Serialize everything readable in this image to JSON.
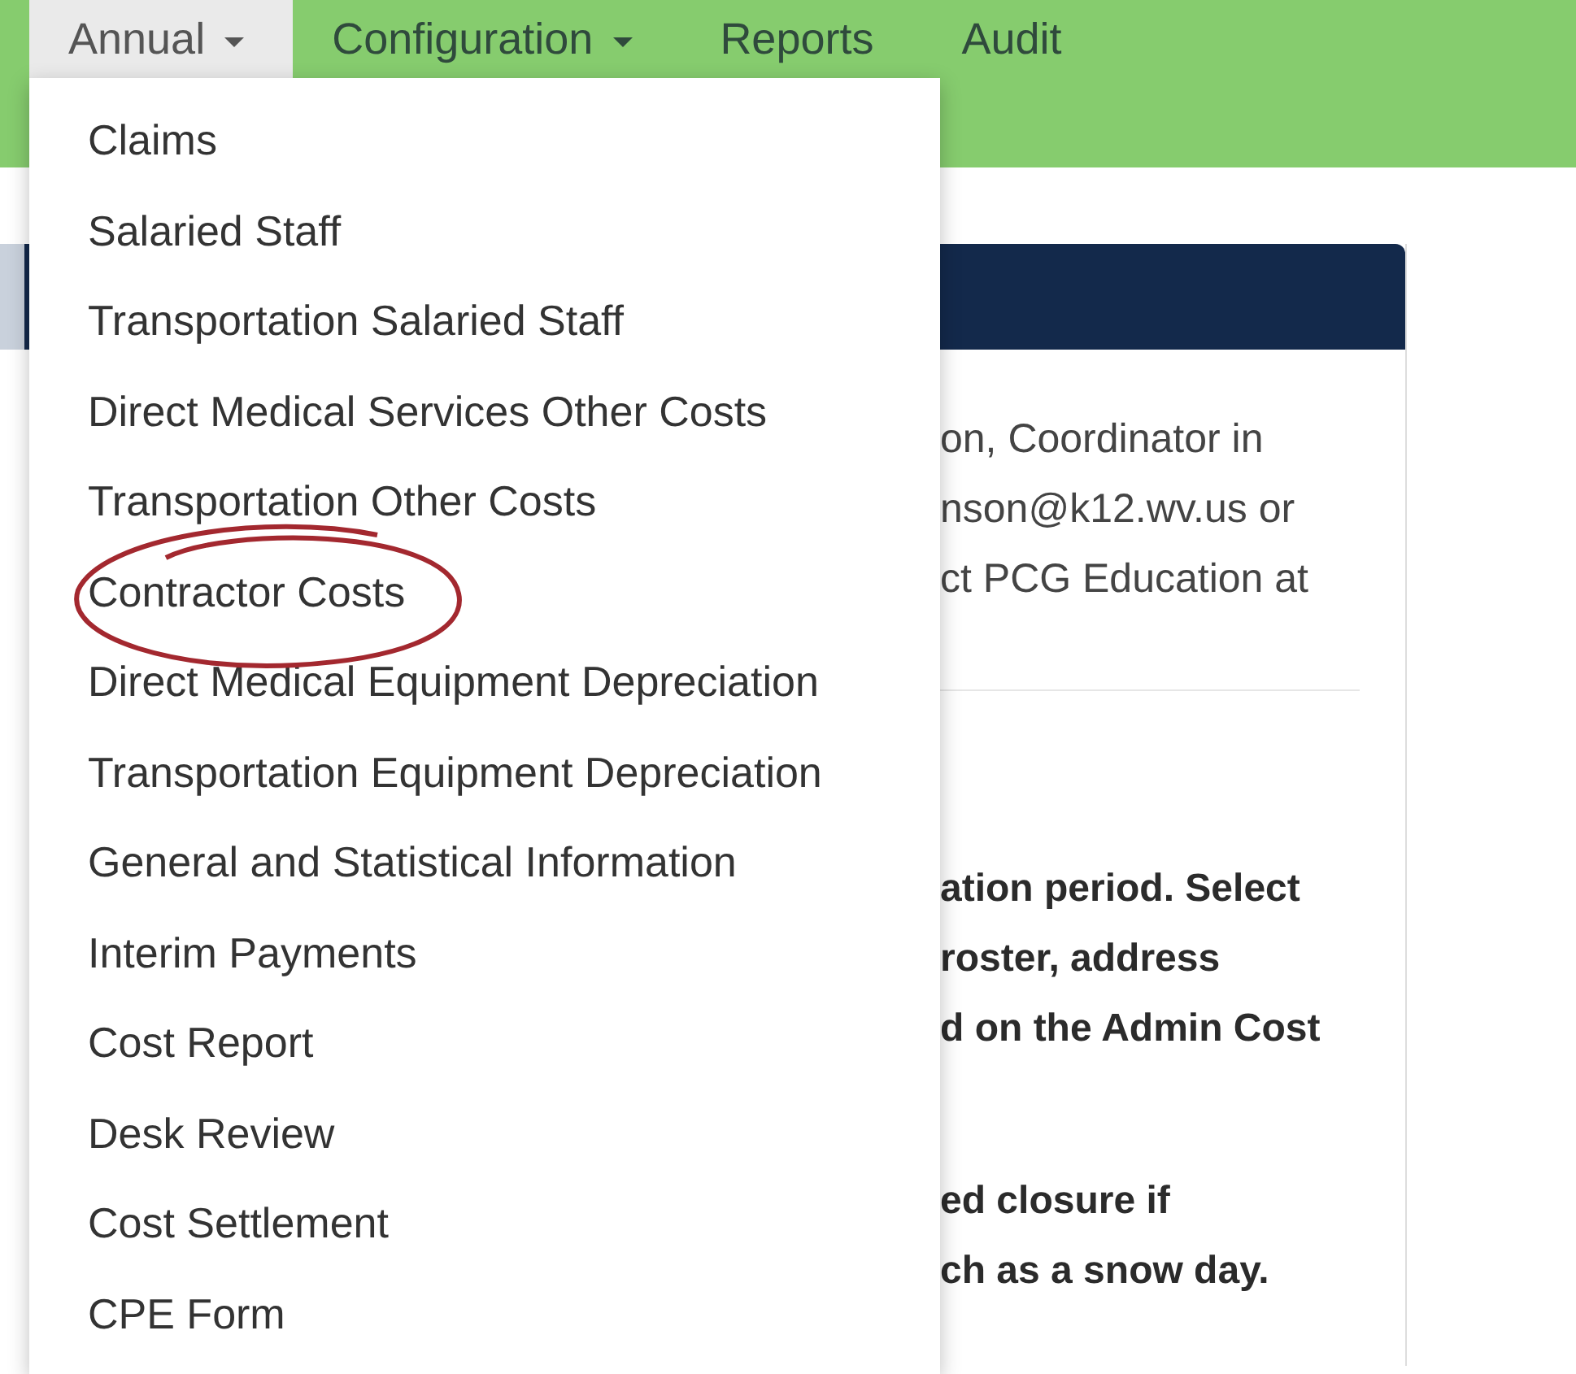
{
  "nav": {
    "items": [
      {
        "label": "Annual",
        "caret": true,
        "selected": true
      },
      {
        "label": "Configuration",
        "caret": true,
        "selected": false
      },
      {
        "label": "Reports",
        "caret": false,
        "selected": false
      },
      {
        "label": "Audit",
        "caret": false,
        "selected": false
      }
    ]
  },
  "dropdown": {
    "items": [
      {
        "label": "Claims",
        "circled": false
      },
      {
        "label": "Salaried Staff",
        "circled": false
      },
      {
        "label": "Transportation Salaried Staff",
        "circled": false
      },
      {
        "label": "Direct Medical Services Other Costs",
        "circled": false
      },
      {
        "label": "Transportation Other Costs",
        "circled": false
      },
      {
        "label": "Contractor Costs",
        "circled": true
      },
      {
        "label": "Direct Medical Equipment Depreciation",
        "circled": false
      },
      {
        "label": "Transportation Equipment Depreciation",
        "circled": false
      },
      {
        "label": "General and Statistical Information",
        "circled": false
      },
      {
        "label": "Interim Payments",
        "circled": false
      },
      {
        "label": "Cost Report",
        "circled": false
      },
      {
        "label": "Desk Review",
        "circled": false
      },
      {
        "label": "Cost Settlement",
        "circled": false
      },
      {
        "label": "CPE Form",
        "circled": false
      }
    ]
  },
  "panel": {
    "paragraphs": [
      {
        "bold": false,
        "lines": [
          "on, Coordinator in",
          "nson@k12.wv.us or",
          "ct PCG Education at"
        ]
      },
      {
        "bold": true,
        "lines": [
          "ation period. Select",
          "roster, address",
          "d on the Admin Cost"
        ]
      },
      {
        "bold": true,
        "lines": [
          "ed closure if",
          "ch as a snow day."
        ]
      }
    ]
  }
}
